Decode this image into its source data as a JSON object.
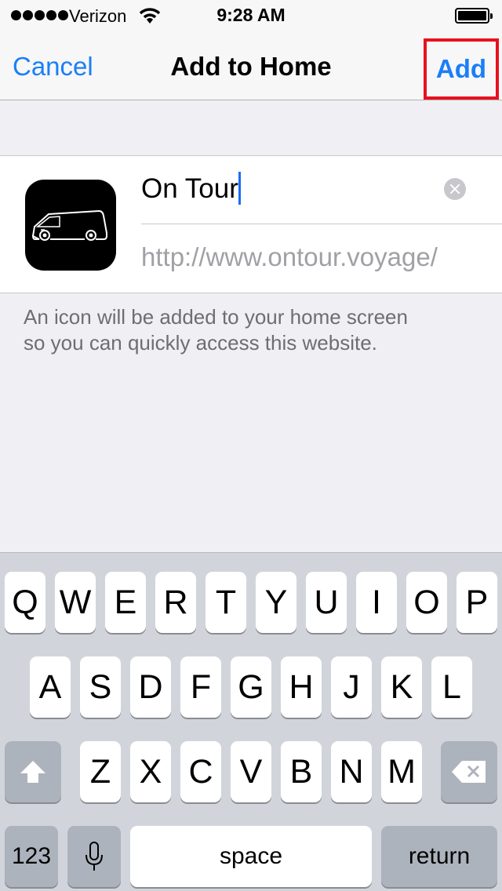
{
  "status_bar": {
    "carrier": "Verizon",
    "time": "9:28 AM",
    "signal_bars": 5,
    "wifi_icon": "wifi-icon",
    "battery_icon": "battery-icon",
    "battery_level": 1.0
  },
  "nav": {
    "cancel_label": "Cancel",
    "title": "Add to Home",
    "add_label": "Add",
    "accent_color": "#1a7ff7",
    "highlight_color": "#e8101e"
  },
  "form": {
    "icon": "van-icon",
    "name_value": "On Tour",
    "clear_icon": "clear-icon",
    "url": "http://www.ontour.voyage/"
  },
  "note": {
    "line1": "An icon will be added to your home screen",
    "line2": "so you can quickly access this website."
  },
  "keyboard": {
    "row1": [
      "Q",
      "W",
      "E",
      "R",
      "T",
      "Y",
      "U",
      "I",
      "O",
      "P"
    ],
    "row2": [
      "A",
      "S",
      "D",
      "F",
      "G",
      "H",
      "J",
      "K",
      "L"
    ],
    "row3": [
      "Z",
      "X",
      "C",
      "V",
      "B",
      "N",
      "M"
    ],
    "shift_icon": "shift-icon",
    "delete_icon": "delete-icon",
    "numbers_label": "123",
    "mic_icon": "microphone-icon",
    "space_label": "space",
    "return_label": "return"
  }
}
